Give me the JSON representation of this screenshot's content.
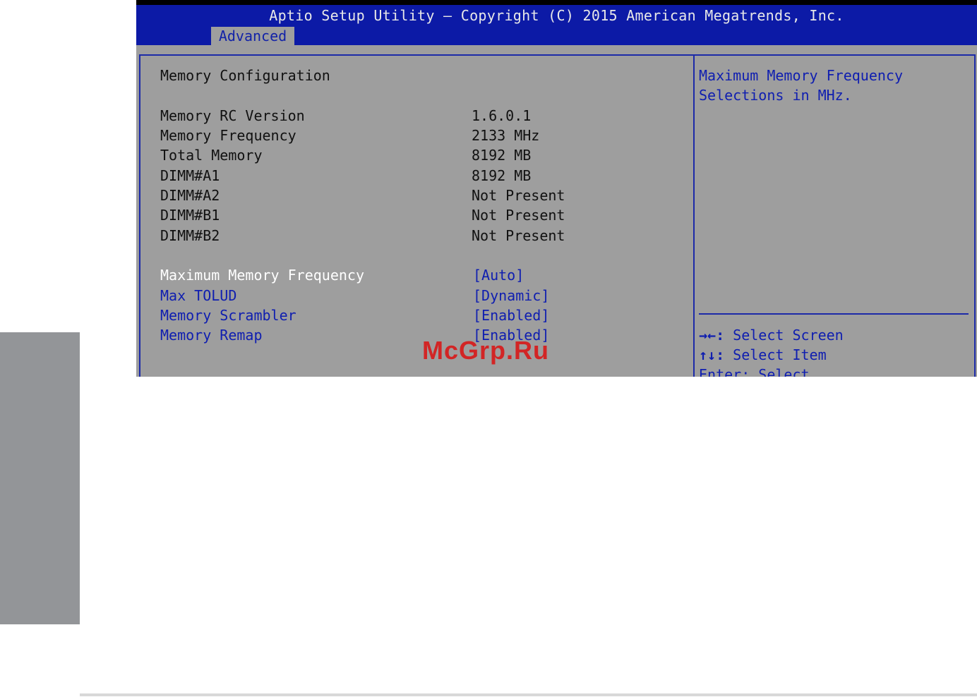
{
  "header": {
    "title": "Aptio Setup Utility – Copyright (C) 2015 American Megatrends, Inc.",
    "active_tab": "Advanced"
  },
  "main": {
    "section_title": "Memory Configuration",
    "info_rows": [
      {
        "label": "Memory RC Version",
        "value": "1.6.0.1"
      },
      {
        "label": "Memory Frequency",
        "value": "2133 MHz"
      },
      {
        "label": "Total Memory",
        "value": "8192 MB"
      },
      {
        "label": "DIMM#A1",
        "value": "8192 MB"
      },
      {
        "label": "DIMM#A2",
        "value": "Not Present"
      },
      {
        "label": "DIMM#B1",
        "value": "Not Present"
      },
      {
        "label": "DIMM#B2",
        "value": "Not Present"
      }
    ],
    "settings": [
      {
        "label": "Maximum Memory Frequency",
        "value": "[Auto]"
      },
      {
        "label": "Max TOLUD",
        "value": "[Dynamic]"
      },
      {
        "label": "Memory Scrambler",
        "value": "[Enabled]"
      },
      {
        "label": "Memory Remap",
        "value": "[Enabled]"
      }
    ]
  },
  "help": {
    "description_line1": "Maximum Memory Frequency",
    "description_line2": "Selections in MHz.",
    "keys": [
      {
        "key": "→←:",
        "action": "Select Screen"
      },
      {
        "key": "↑↓:",
        "action": "Select Item"
      },
      {
        "key": "Enter:",
        "action": "Select"
      }
    ]
  },
  "watermark": "McGrp.Ru",
  "colors": {
    "header_blue": "#0c1aa6",
    "panel_gray": "#9e9e9e",
    "selected_text": "#ffffff",
    "option_blue": "#0f1eb0"
  }
}
